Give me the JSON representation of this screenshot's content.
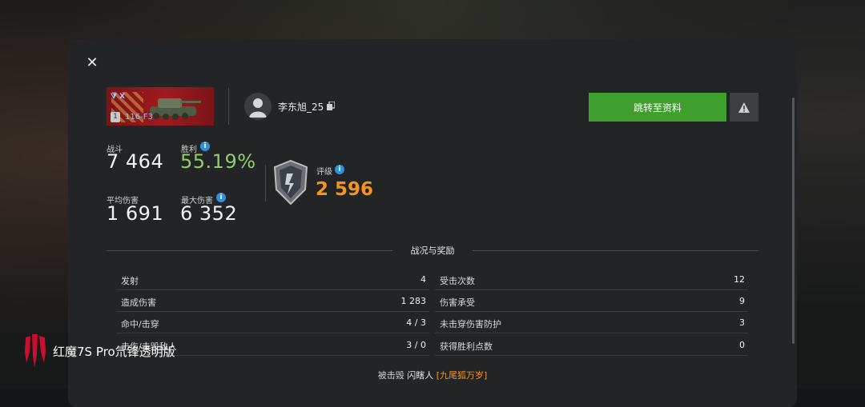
{
  "dialog": {
    "close_icon": "close-icon"
  },
  "vehicle": {
    "tier_badge": "X",
    "level": "1",
    "name": "116-F3"
  },
  "player": {
    "name": "李东旭_25",
    "copy_icon": "copy-icon"
  },
  "buttons": {
    "go_to_profile": "跳转至资料",
    "report_icon": "warning-icon"
  },
  "stats": {
    "battles_label": "战斗",
    "battles_value": "7 464",
    "winrate_label": "胜利",
    "winrate_value": "55.19%",
    "avg_damage_label": "平均伤害",
    "avg_damage_value": "1 691",
    "max_damage_label": "最大伤害",
    "max_damage_value": "6 352",
    "rating_label": "评级",
    "rating_value": "2 596"
  },
  "section": {
    "title": "战况与奖励"
  },
  "battle_left": [
    {
      "label": "发射",
      "value": "4"
    },
    {
      "label": "造成伤害",
      "value": "1 283"
    },
    {
      "label": "命中/击穿",
      "value": "4 / 3"
    },
    {
      "label": "击伤/击毁敌人",
      "value": "3 / 0"
    }
  ],
  "battle_right": [
    {
      "label": "受击次数",
      "value": "12"
    },
    {
      "label": "伤害承受",
      "value": "9"
    },
    {
      "label": "未击穿伤害防护",
      "value": "3"
    },
    {
      "label": "获得胜利点数",
      "value": "0"
    }
  ],
  "destroyed_by": {
    "prefix": "被击毁",
    "killer": "闪瞎人",
    "clan": "[九尾狐万岁]"
  },
  "watermark": {
    "text": "红魔7S Pro氘锋透明版"
  },
  "colors": {
    "accent_green": "#3f9f2e",
    "rating_orange": "#f7941d",
    "winrate_green": "#8fcf6a",
    "info_blue": "#2f8fe0"
  }
}
